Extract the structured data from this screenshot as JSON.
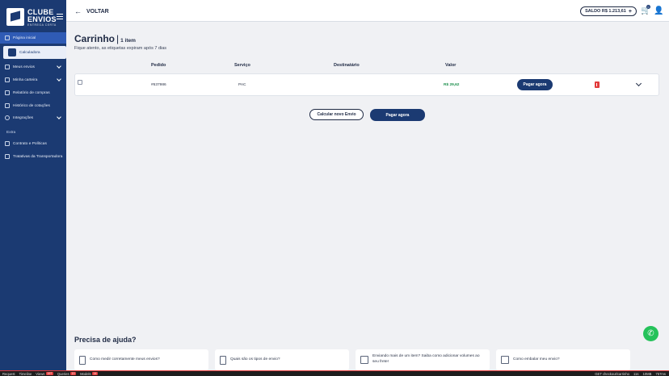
{
  "sidebar": {
    "logo_line1": "CLUBE",
    "logo_line2": "ENVIOS",
    "logo_tagline": "ENTREGA CERTA",
    "items": [
      {
        "label": "Página inicial"
      },
      {
        "label": "Calculadora"
      },
      {
        "label": "Meus envios"
      },
      {
        "label": "Minha carteira"
      },
      {
        "label": "Relatório de compras"
      },
      {
        "label": "Histórico de cotações"
      },
      {
        "label": "Integrações"
      }
    ],
    "extra_title": "Extra",
    "extra_items": [
      {
        "label": "Contrato e Políticas"
      },
      {
        "label": "Tratativas da Transportadora"
      }
    ]
  },
  "header": {
    "back_label": "VOLTAR",
    "saldo_label": "SALDO R$ 1.213,61",
    "cart_count": "0"
  },
  "main": {
    "title": "Carrinho",
    "item_count": "1 item",
    "subtitle": "Fique atento, as etiquetas expiram após 7 dias",
    "columns": [
      "Pedido",
      "Serviço",
      "Destinatário",
      "Valor"
    ],
    "rows": [
      {
        "pedido": "#637986",
        "servico": "PAC",
        "destinatario": "",
        "valor": "R$ 29,62",
        "action": "Pagar agora"
      }
    ],
    "calc_button": "Calcular novo Envio",
    "pay_button": "Pagar agora"
  },
  "help": {
    "title": "Precisa de ajuda?",
    "cards": [
      {
        "text": "Como medir corretamente meus envios?"
      },
      {
        "text": "Quais são os tipos de envio?"
      },
      {
        "text": "Enviando mais de um item? Saiba como adicionar volumes ao seu frete!"
      },
      {
        "text": "Como embalar meu envio?"
      }
    ]
  },
  "devbar": {
    "items": [
      "Request",
      "Timeline",
      "Views",
      "Queries",
      "Models"
    ],
    "badges": [
      "197",
      "13",
      "14"
    ],
    "route": "GET checkout/carrinho",
    "stats": [
      "11s",
      "10MB",
      "757ms"
    ]
  },
  "colors": {
    "sidebar": "#1b3a72",
    "accent": "#2f5bb5",
    "price": "#1d8f4d",
    "danger": "#e23b3b",
    "whatsapp": "#25c25a"
  }
}
